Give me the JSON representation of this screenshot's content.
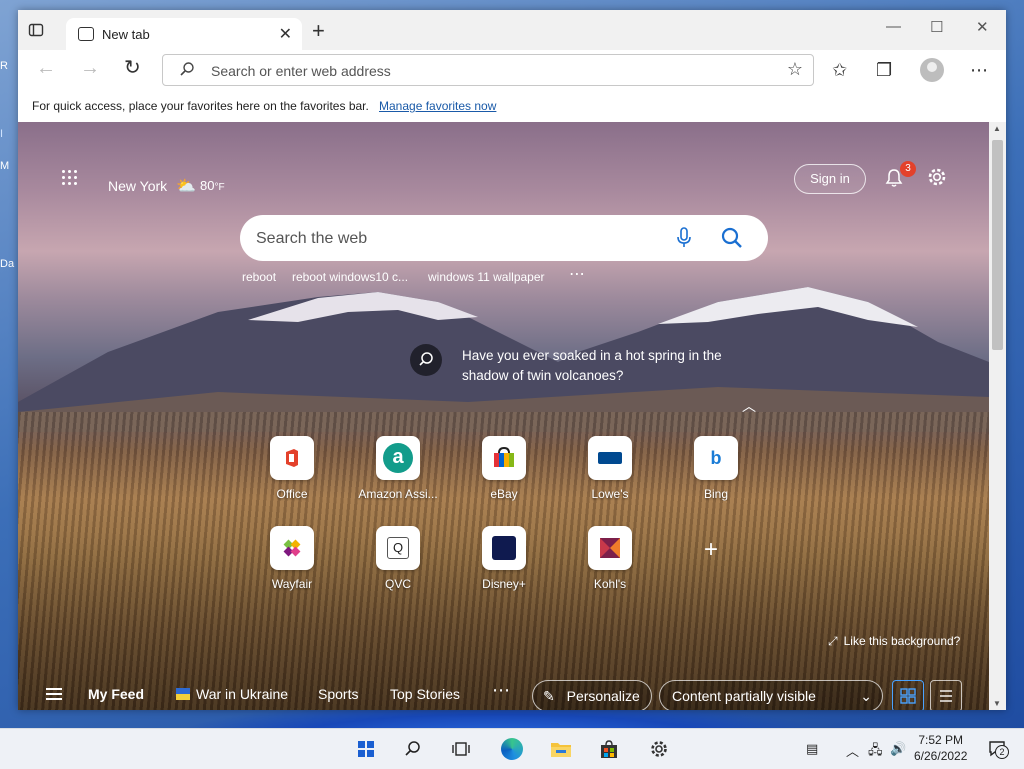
{
  "desktop": {
    "edge_letters": [
      "R",
      "I",
      "M",
      "Da"
    ]
  },
  "browser": {
    "tab_title": "New tab",
    "address_placeholder": "Search or enter web address",
    "favorites_message": "For quick access, place your favorites here on the favorites bar.",
    "favorites_link": "Manage favorites now"
  },
  "ntp": {
    "weather": {
      "city": "New York",
      "temp": "80",
      "unit": "°F",
      "icon": "partly-cloudy-icon"
    },
    "signin_label": "Sign in",
    "notification_count": "3",
    "search_placeholder": "Search the web",
    "trending": [
      "reboot",
      "reboot windows10 c...",
      "windows 11 wallpaper"
    ],
    "image_caption": "Have you ever soaked in a hot spring in the shadow of twin volcanoes?",
    "quick_links": [
      {
        "label": "Office",
        "icon": "office-icon"
      },
      {
        "label": "Amazon Assi...",
        "icon": "amazon-assistant-icon"
      },
      {
        "label": "eBay",
        "icon": "ebay-icon"
      },
      {
        "label": "Lowe's",
        "icon": "lowes-icon"
      },
      {
        "label": "Bing",
        "icon": "bing-icon"
      },
      {
        "label": "Wayfair",
        "icon": "wayfair-icon"
      },
      {
        "label": "QVC",
        "icon": "qvc-icon"
      },
      {
        "label": "Disney+",
        "icon": "disney-plus-icon"
      },
      {
        "label": "Kohl's",
        "icon": "kohls-icon"
      }
    ],
    "like_background": "Like this background?",
    "feed": {
      "items": [
        "My Feed",
        "War in Ukraine",
        "Sports",
        "Top Stories"
      ],
      "personalize": "Personalize",
      "content_visibility": "Content partially visible"
    }
  },
  "taskbar": {
    "time": "7:52 PM",
    "date": "6/26/2022",
    "notification_count": "2"
  },
  "colors": {
    "accent": "#0078d4",
    "bell_badge": "#e3412b"
  }
}
